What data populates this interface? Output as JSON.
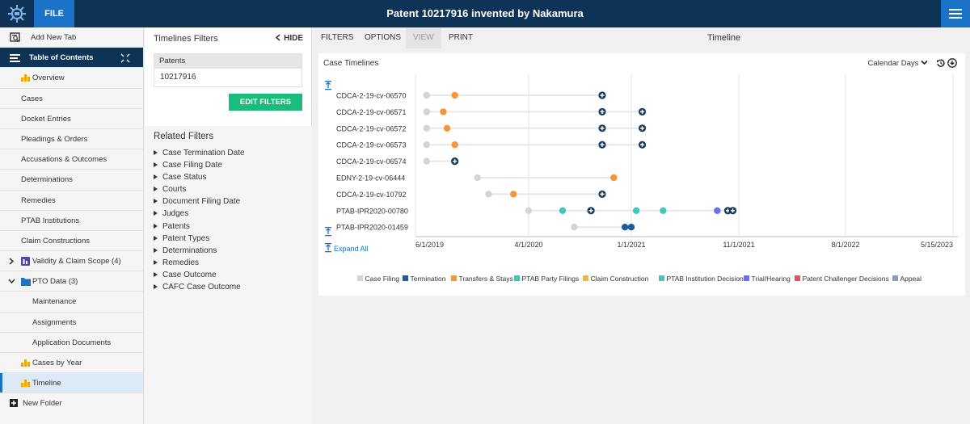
{
  "header": {
    "file_label": "FILE",
    "title": "Patent 10217916 invented by Nakamura"
  },
  "sidebar": {
    "add_tab": "Add New Tab",
    "toc": "Table of Contents",
    "items": [
      {
        "label": "Overview",
        "icon": "bar-chart-icon"
      },
      {
        "label": "Cases"
      },
      {
        "label": "Docket Entries"
      },
      {
        "label": "Pleadings & Orders"
      },
      {
        "label": "Accusations & Outcomes"
      },
      {
        "label": "Determinations"
      },
      {
        "label": "Remedies"
      },
      {
        "label": "PTAB Institutions"
      },
      {
        "label": "Claim Constructions"
      },
      {
        "label": "Validity & Claim Scope (4)",
        "icon": "chevron-right-icon"
      },
      {
        "label": "PTO Data (3)",
        "icon": "folder-icon"
      },
      {
        "label": "Maintenance"
      },
      {
        "label": "Assignments"
      },
      {
        "label": "Application Documents"
      },
      {
        "label": "Cases by Year",
        "icon": "bar-chart-icon"
      },
      {
        "label": "Timeline",
        "icon": "bar-chart-icon"
      }
    ],
    "new_folder": "New Folder"
  },
  "filters": {
    "title": "Timelines Filters",
    "hide": "HIDE",
    "patents_header": "Patents",
    "patents_value": "10217916",
    "edit_button": "EDIT FILTERS",
    "related_title": "Related Filters",
    "related": [
      "Case Termination Date",
      "Case Filing Date",
      "Case Status",
      "Courts",
      "Document Filing Date",
      "Judges",
      "Patents",
      "Patent Types",
      "Determinations",
      "Remedies",
      "Case Outcome",
      "CAFC Case Outcome"
    ]
  },
  "toolbar": {
    "filters": "FILTERS",
    "options": "OPTIONS",
    "view": "VIEW",
    "print": "PRINT",
    "title": "Timeline"
  },
  "card": {
    "title": "Case Timelines",
    "calendar": "Calendar Days",
    "expand_all": "Expand All"
  },
  "colors": {
    "case_filing": "#d4d4d4",
    "termination": "#1c5d99",
    "transfers": "#f7953b",
    "ptab_party": "#45c4b8",
    "claim_construction": "#f7b731",
    "ptab_institution": "#3fc7c0",
    "trial": "#6b6ff0",
    "challenger": "#f04a5e",
    "appeal": "#8e9cb5",
    "end_marker": "#12395e"
  },
  "chart_data": {
    "type": "scatter",
    "title": "Case Timelines",
    "x_ticks": [
      "6/1/2019",
      "4/1/2020",
      "1/1/2021",
      "11/1/2021",
      "8/1/2022",
      "5/15/2023"
    ],
    "x_range": [
      "2019-06-01",
      "2023-05-15"
    ],
    "rows": [
      {
        "label": "CDCA-2-19-cv-06570",
        "events": [
          {
            "date": "2019-07-01",
            "type": "case_filing"
          },
          {
            "date": "2019-09-15",
            "type": "transfers"
          },
          {
            "date": "2020-10-15",
            "type": "end"
          }
        ]
      },
      {
        "label": "CDCA-2-19-cv-06571",
        "events": [
          {
            "date": "2019-07-01",
            "type": "case_filing"
          },
          {
            "date": "2019-08-15",
            "type": "transfers"
          },
          {
            "date": "2020-10-15",
            "type": "end"
          },
          {
            "date": "2021-02-01",
            "type": "end"
          }
        ]
      },
      {
        "label": "CDCA-2-19-cv-06572",
        "events": [
          {
            "date": "2019-07-01",
            "type": "case_filing"
          },
          {
            "date": "2019-08-25",
            "type": "transfers"
          },
          {
            "date": "2020-10-15",
            "type": "end"
          },
          {
            "date": "2021-02-01",
            "type": "end"
          }
        ]
      },
      {
        "label": "CDCA-2-19-cv-06573",
        "events": [
          {
            "date": "2019-07-01",
            "type": "case_filing"
          },
          {
            "date": "2019-09-15",
            "type": "transfers"
          },
          {
            "date": "2020-10-15",
            "type": "end"
          },
          {
            "date": "2021-02-01",
            "type": "end"
          }
        ]
      },
      {
        "label": "CDCA-2-19-cv-06574",
        "events": [
          {
            "date": "2019-07-01",
            "type": "case_filing"
          },
          {
            "date": "2019-09-15",
            "type": "end"
          }
        ]
      },
      {
        "label": "EDNY-2-19-cv-06444",
        "events": [
          {
            "date": "2019-11-15",
            "type": "case_filing"
          },
          {
            "date": "2020-11-15",
            "type": "transfers"
          }
        ]
      },
      {
        "label": "CDCA-2-19-cv-10792",
        "events": [
          {
            "date": "2019-12-15",
            "type": "case_filing"
          },
          {
            "date": "2020-02-20",
            "type": "transfers"
          },
          {
            "date": "2020-10-15",
            "type": "end"
          }
        ]
      },
      {
        "label": "PTAB-IPR2020-00780",
        "events": [
          {
            "date": "2020-04-01",
            "type": "case_filing"
          },
          {
            "date": "2020-07-01",
            "type": "ptab_party"
          },
          {
            "date": "2020-09-15",
            "type": "end"
          },
          {
            "date": "2021-01-15",
            "type": "ptab_institution"
          },
          {
            "date": "2021-04-01",
            "type": "ptab_institution"
          },
          {
            "date": "2021-09-01",
            "type": "trial"
          },
          {
            "date": "2021-10-01",
            "type": "end"
          },
          {
            "date": "2021-10-15",
            "type": "end"
          }
        ]
      },
      {
        "label": "PTAB-IPR2020-01459",
        "events": [
          {
            "date": "2020-08-01",
            "type": "case_filing"
          },
          {
            "date": "2020-12-15",
            "type": "termination"
          },
          {
            "date": "2021-01-01",
            "type": "termination"
          }
        ]
      }
    ],
    "legend": [
      {
        "name": "Case Filing",
        "key": "case_filing"
      },
      {
        "name": "Termination",
        "key": "termination"
      },
      {
        "name": "Transfers & Stays",
        "key": "transfers"
      },
      {
        "name": "PTAB Party Filings",
        "key": "ptab_party"
      },
      {
        "name": "Claim Construction",
        "key": "claim_construction"
      },
      {
        "name": "PTAB Institution Decision",
        "key": "ptab_institution"
      },
      {
        "name": "Trial/Hearing",
        "key": "trial"
      },
      {
        "name": "Patent Challenger Decisions",
        "key": "challenger"
      },
      {
        "name": "Appeal",
        "key": "appeal"
      }
    ],
    "grid": true,
    "legend_position": "bottom"
  }
}
